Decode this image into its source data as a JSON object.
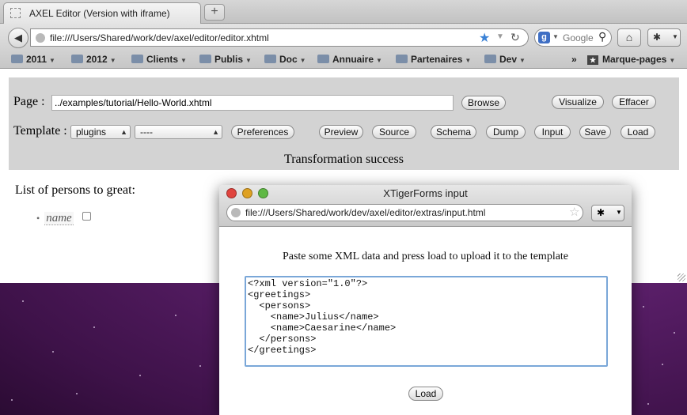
{
  "browser": {
    "tab_title": "AXEL Editor (Version with iframe)",
    "new_tab_symbol": "+",
    "url": "file:///Users/Shared/work/dev/axel/editor/editor.xhtml",
    "search_placeholder": "Google",
    "bookmarks": [
      {
        "label": "2011"
      },
      {
        "label": "2012"
      },
      {
        "label": "Clients"
      },
      {
        "label": "Publis"
      },
      {
        "label": "Doc"
      },
      {
        "label": "Annuaire"
      },
      {
        "label": "Partenaires"
      },
      {
        "label": "Dev"
      }
    ],
    "overflow_symbol": "»",
    "bookmarks_menu": "Marque-pages"
  },
  "editor": {
    "page_label": "Page :",
    "page_value": "../examples/tutorial/Hello-World.xhtml",
    "browse_label": "Browse",
    "visualize_label": "Visualize",
    "clear_label": "Effacer",
    "template_label": "Template :",
    "template_select": "plugins",
    "template_file_select": "----",
    "preferences_label": "Preferences",
    "preview_label": "Preview",
    "source_label": "Source",
    "schema_label": "Schema",
    "dump_label": "Dump",
    "input_label": "Input",
    "save_label": "Save",
    "load_label": "Load",
    "status": "Transformation success"
  },
  "document": {
    "heading": "List of persons to great:",
    "bullet": "•",
    "item_name": "name"
  },
  "popup": {
    "title": "XTigerForms input",
    "url": "file:///Users/Shared/work/dev/axel/editor/extras/input.html",
    "instruction": "Paste some XML data and press load to upload it to the template",
    "xml": "<?xml version=\"1.0\"?>\n<greetings>\n  <persons>\n    <name>Julius</name>\n    <name>Caesarine</name>\n  </persons>\n</greetings>\n",
    "load_label": "Load"
  },
  "colors": {
    "desktop": "#5b1f6a",
    "panel": "#d3d3d3",
    "bookmark_star": "#3b82d6",
    "close": "#e0443e",
    "minimize": "#dea123",
    "zoom": "#5fb844",
    "focus_ring": "#7aa7d8"
  },
  "icons": {
    "back": "back-arrow-icon",
    "globe": "globe-icon",
    "star": "bookmark-star-icon",
    "reload": "reload-icon",
    "search": "magnifier-icon",
    "home": "home-icon",
    "addon": "addon-icon",
    "folder": "folder-icon"
  }
}
